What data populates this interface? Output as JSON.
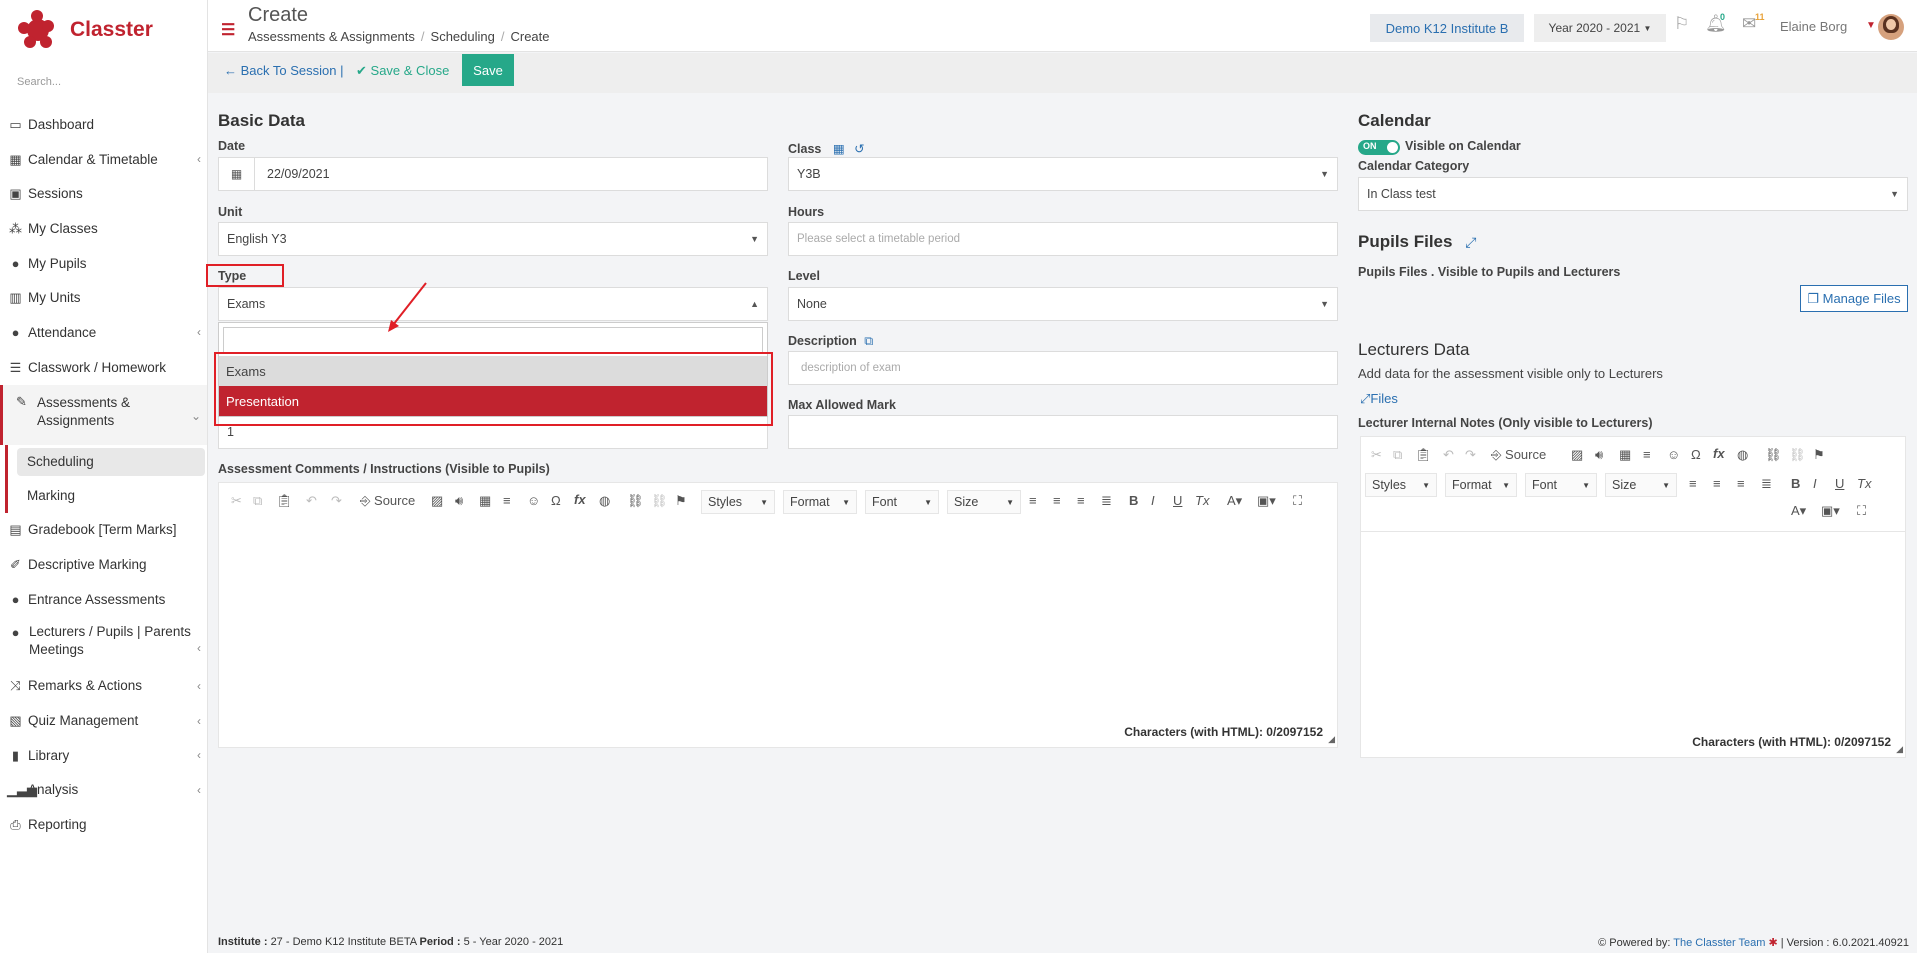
{
  "app": {
    "name": "Classter"
  },
  "sidebar": {
    "search_placeholder": "Search...",
    "items": [
      {
        "label": "Dashboard",
        "icon": "monitor-icon",
        "chevron": false
      },
      {
        "label": "Calendar & Timetable",
        "icon": "calendar-icon",
        "chevron": true
      },
      {
        "label": "Sessions",
        "icon": "presentation-icon",
        "chevron": false
      },
      {
        "label": "My Classes",
        "icon": "users-grid-icon",
        "chevron": false
      },
      {
        "label": "My Pupils",
        "icon": "users-icon",
        "chevron": false
      },
      {
        "label": "My Units",
        "icon": "book-icon",
        "chevron": false
      },
      {
        "label": "Attendance",
        "icon": "user-check-icon",
        "chevron": true
      },
      {
        "label": "Classwork / Homework",
        "icon": "list-icon",
        "chevron": false
      },
      {
        "label": "Assessments & Assignments",
        "icon": "edit-icon",
        "chevron": true
      },
      {
        "label": "Scheduling",
        "icon": "",
        "chevron": false
      },
      {
        "label": "Marking",
        "icon": "",
        "chevron": false
      },
      {
        "label": "Gradebook [Term Marks]",
        "icon": "gradebook-icon",
        "chevron": false
      },
      {
        "label": "Descriptive Marking",
        "icon": "pencil-square-icon",
        "chevron": false
      },
      {
        "label": "Entrance Assessments",
        "icon": "user-edit-icon",
        "chevron": false
      },
      {
        "label": "Lecturers / Pupils | Parents Meetings",
        "icon": "meeting-icon",
        "chevron": true
      },
      {
        "label": "Remarks & Actions",
        "icon": "shuffle-icon",
        "chevron": true
      },
      {
        "label": "Quiz Management",
        "icon": "quiz-icon",
        "chevron": true
      },
      {
        "label": "Library",
        "icon": "library-icon",
        "chevron": true
      },
      {
        "label": "Analysis",
        "icon": "bar-chart-icon",
        "chevron": true
      },
      {
        "label": "Reporting",
        "icon": "printer-icon",
        "chevron": false
      }
    ]
  },
  "header": {
    "title": "Create",
    "breadcrumbs": [
      "Assessments & Assignments",
      "Scheduling",
      "Create"
    ],
    "institute": "Demo K12 Institute B",
    "year": "Year 2020 - 2021",
    "notif_count": "0",
    "mail_count": "11",
    "user_name": "Elaine Borg"
  },
  "actions": {
    "back": "Back To Session |",
    "save_close": "Save & Close",
    "save": "Save"
  },
  "basic": {
    "heading": "Basic Data",
    "date_label": "Date",
    "date_value": "22/09/2021",
    "class_label": "Class",
    "class_value": "Y3B",
    "unit_label": "Unit",
    "unit_value": "English Y3",
    "hours_label": "Hours",
    "hours_placeholder": "Please select a timetable period",
    "type_label": "Type",
    "type_value": "Exams",
    "level_label": "Level",
    "level_value": "None",
    "description_label": "Description",
    "description_placeholder": "description of exam",
    "max_mark_label": "Max Allowed Mark",
    "hidden_value": "1",
    "type_options": [
      "Exams",
      "Presentation"
    ]
  },
  "comments": {
    "label": "Assessment Comments / Instructions (Visible to Pupils)",
    "chars": "Characters (with HTML): 0/2097152"
  },
  "toolbar": {
    "source": "Source",
    "styles": "Styles",
    "format": "Format",
    "font": "Font",
    "size": "Size"
  },
  "calendar": {
    "heading": "Calendar",
    "toggle": "ON",
    "visible_label": "Visible on Calendar",
    "category_label": "Calendar Category",
    "category_value": "In Class test"
  },
  "pupils_files": {
    "heading": "Pupils Files",
    "desc": "Pupils Files . Visible to Pupils and Lecturers",
    "manage": "Manage Files"
  },
  "lecturers": {
    "heading": "Lecturers Data",
    "desc": "Add data for the assessment visible only to Lecturers",
    "files": "Files",
    "notes_label": "Lecturer Internal Notes (Only visible to Lecturers)",
    "chars": "Characters (with HTML): 0/2097152"
  },
  "footer": {
    "institute_label": "Institute :",
    "institute_value": "27 - Demo K12 Institute BETA",
    "period_label": "Period :",
    "period_value": "5 - Year 2020 - 2021",
    "powered_by": "Powered by:",
    "team": "The Classter Team",
    "version": "| Version : 6.0.2021.40921"
  },
  "colors": {
    "brand": "#c0232f",
    "accent": "#26a889",
    "link": "#2a6fb0",
    "annotation": "#e01f26"
  }
}
